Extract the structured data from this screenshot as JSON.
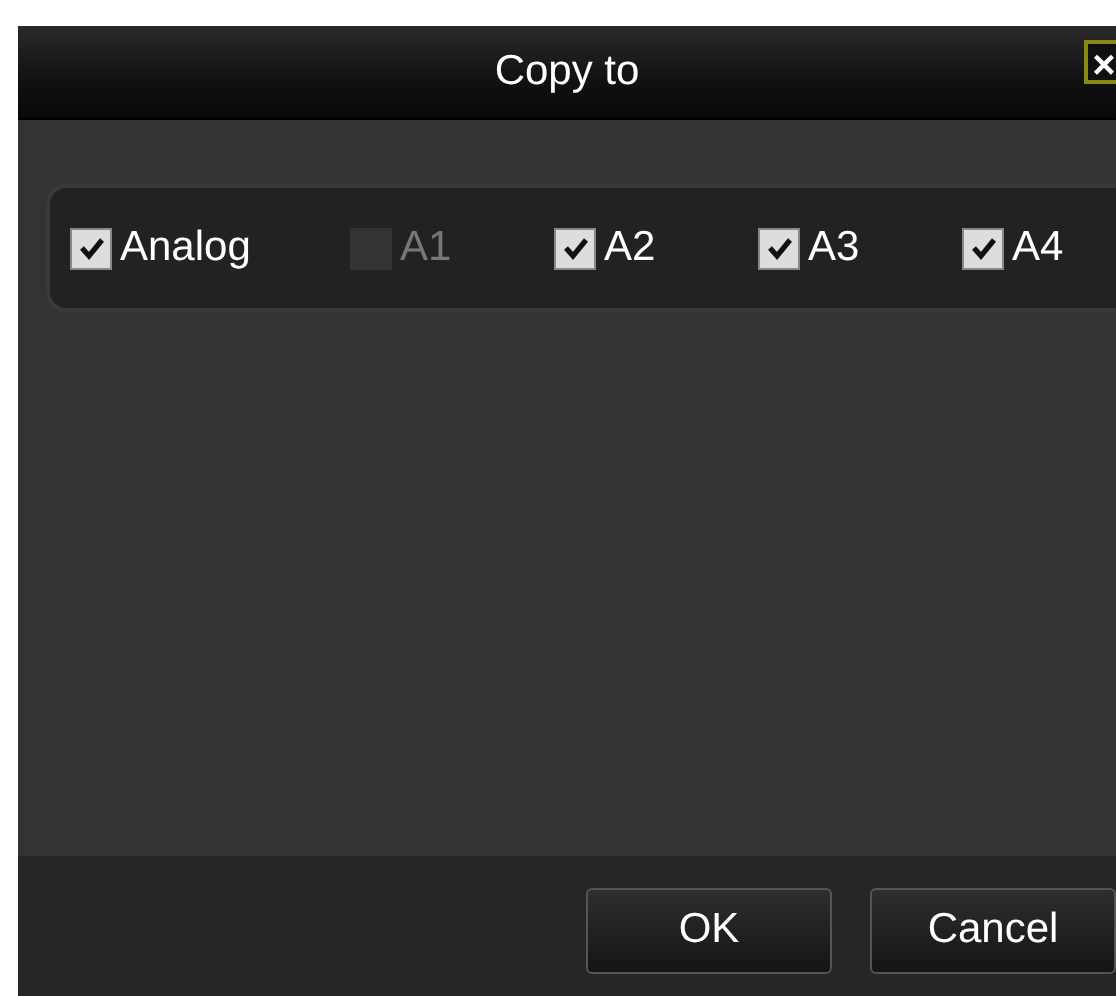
{
  "window": {
    "title": "Copy to",
    "close": "×"
  },
  "channels": [
    {
      "label": "Analog",
      "checked": true,
      "disabled": false
    },
    {
      "label": "A1",
      "checked": false,
      "disabled": true
    },
    {
      "label": "A2",
      "checked": true,
      "disabled": false
    },
    {
      "label": "A3",
      "checked": true,
      "disabled": false
    },
    {
      "label": "A4",
      "checked": true,
      "disabled": false
    }
  ],
  "buttons": [
    "OK",
    "Cancel"
  ]
}
